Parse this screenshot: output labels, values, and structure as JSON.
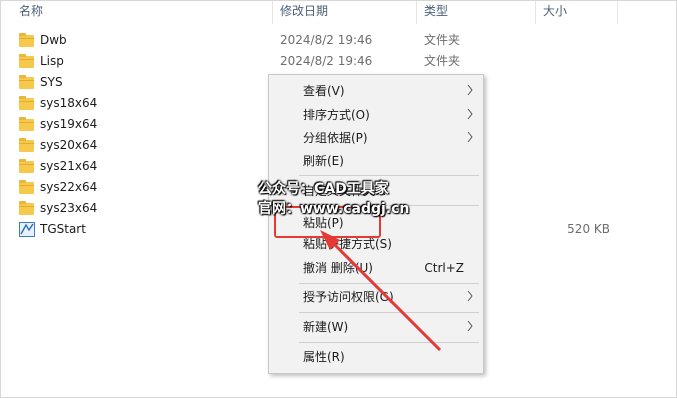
{
  "columns": {
    "name": "名称",
    "date": "修改日期",
    "type": "类型",
    "size": "大小"
  },
  "files": [
    {
      "name": "Dwb",
      "date": "2024/8/2 19:46",
      "type": "文件夹",
      "size": "",
      "icon": "folder-icon"
    },
    {
      "name": "Lisp",
      "date": "2024/8/2 19:46",
      "type": "文件夹",
      "size": "",
      "icon": "folder-icon"
    },
    {
      "name": "SYS",
      "date": "",
      "type": "",
      "size": "",
      "icon": "folder-icon"
    },
    {
      "name": "sys18x64",
      "date": "",
      "type": "",
      "size": "",
      "icon": "folder-icon"
    },
    {
      "name": "sys19x64",
      "date": "",
      "type": "",
      "size": "",
      "icon": "folder-icon"
    },
    {
      "name": "sys20x64",
      "date": "",
      "type": "",
      "size": "",
      "icon": "folder-icon"
    },
    {
      "name": "sys21x64",
      "date": "",
      "type": "",
      "size": "",
      "icon": "folder-icon"
    },
    {
      "name": "sys22x64",
      "date": "",
      "type": "",
      "size": "",
      "icon": "folder-icon"
    },
    {
      "name": "sys23x64",
      "date": "",
      "type": "",
      "size": "",
      "icon": "folder-icon"
    },
    {
      "name": "TGStart",
      "date": "",
      "type": "",
      "size": "520 KB",
      "icon": "app-icon"
    }
  ],
  "context_menu": {
    "items": [
      {
        "label": "查看(V)",
        "shortcut": "",
        "submenu": true
      },
      {
        "label": "排序方式(O)",
        "shortcut": "",
        "submenu": true
      },
      {
        "label": "分组依据(P)",
        "shortcut": "",
        "submenu": true
      },
      {
        "label": "刷新(E)",
        "shortcut": "",
        "submenu": false
      },
      {
        "label": "自定义文件夹...",
        "shortcut": "",
        "submenu": false
      },
      {
        "label": "粘贴(P)",
        "shortcut": "",
        "submenu": false
      },
      {
        "label": "粘贴快捷方式(S)",
        "shortcut": "",
        "submenu": false
      },
      {
        "label": "撤消 删除(U)",
        "shortcut": "Ctrl+Z",
        "submenu": false
      },
      {
        "label": "授予访问权限(G)",
        "shortcut": "",
        "submenu": true
      },
      {
        "label": "新建(W)",
        "shortcut": "",
        "submenu": true
      },
      {
        "label": "属性(R)",
        "shortcut": "",
        "submenu": false
      }
    ]
  },
  "watermark": {
    "line1": "公众号：CAD工具家",
    "line2": "官网：www.cadgj.cn"
  },
  "colors": {
    "folder": "#f6c94d",
    "highlight": "#e53935",
    "menu_bg": "#f2f2f2"
  }
}
